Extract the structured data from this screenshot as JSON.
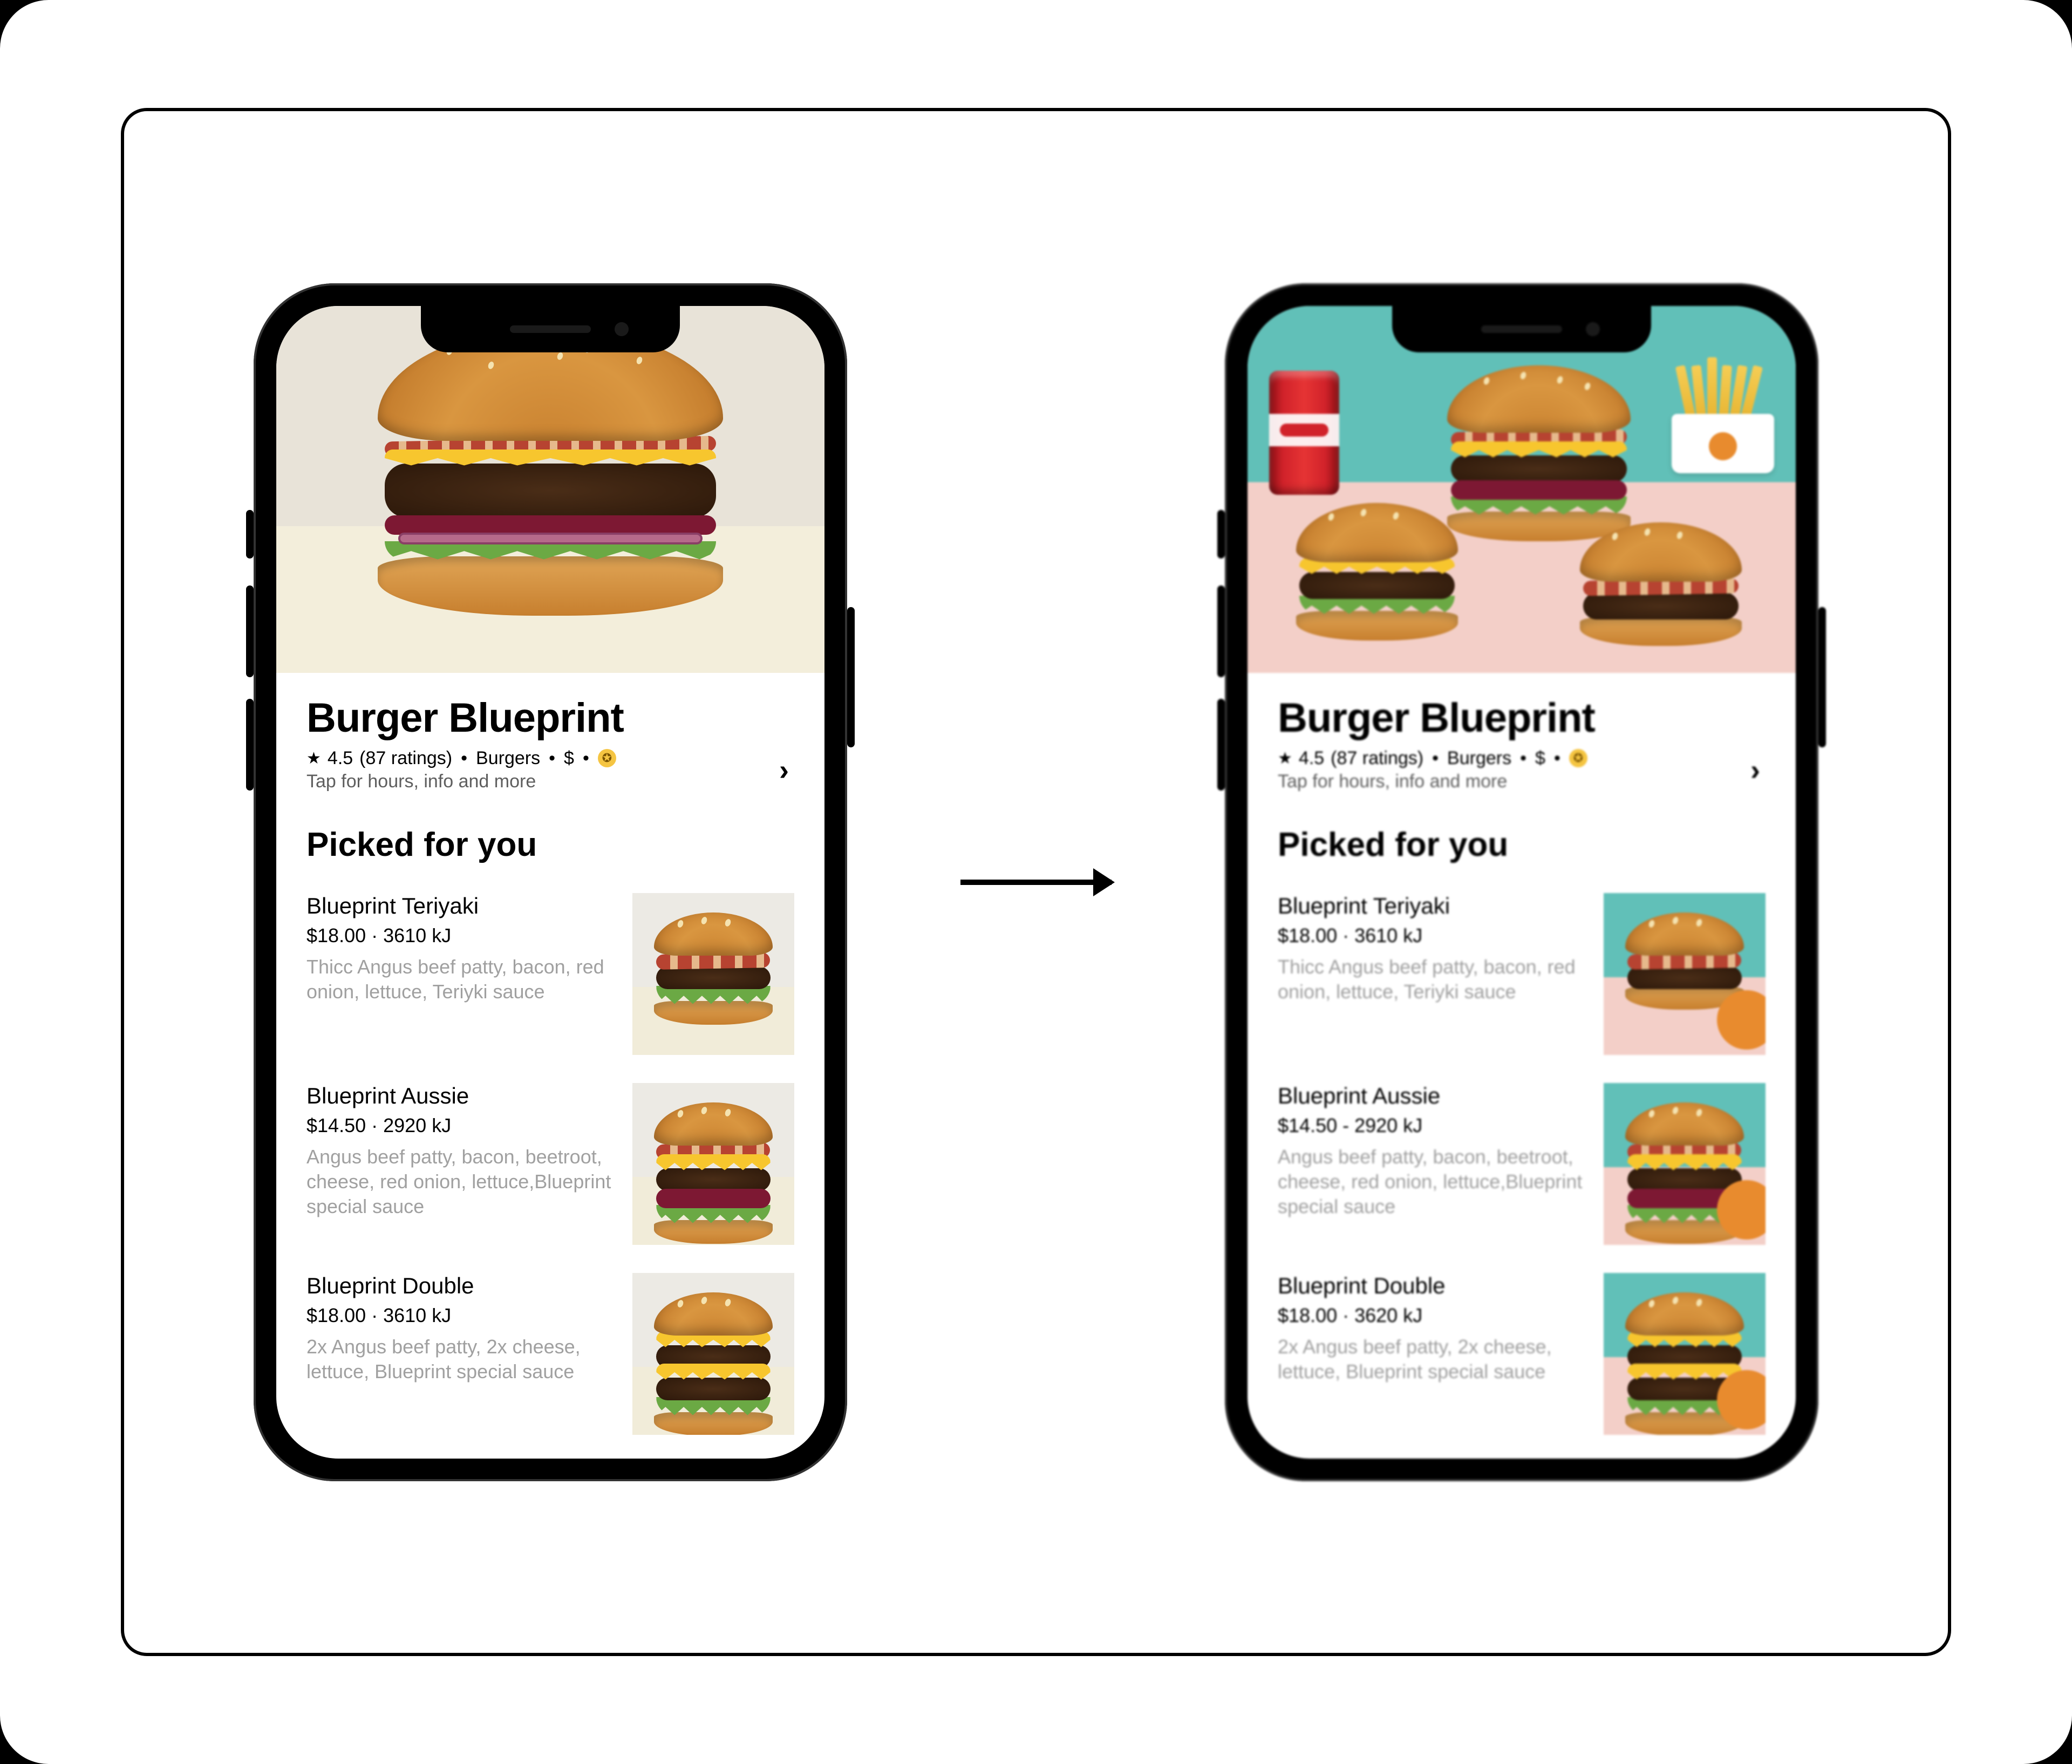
{
  "restaurant": {
    "name": "Burger Blueprint",
    "rating_value": "4.5",
    "rating_count": "(87 ratings)",
    "category": "Burgers",
    "price_tier": "$",
    "tap_hint": "Tap for hours, info and more"
  },
  "section": {
    "heading": "Picked for you"
  },
  "items": [
    {
      "name": "Blueprint Teriyaki",
      "price": "$18.00",
      "kj": "3610 kJ",
      "desc": "Thicc Angus beef patty, bacon, red onion, lettuce, Teriyki sauce"
    },
    {
      "name": "Blueprint Aussie",
      "price": "$14.50",
      "kj": "2920 kJ",
      "desc": "Angus beef patty, bacon, beetroot, cheese, red onion, lettuce,Blueprint special sauce"
    },
    {
      "name": "Blueprint Double",
      "price": "$18.00",
      "kj": "3610 kJ",
      "desc": "2x Angus beef patty, 2x cheese, lettuce, Blueprint special sauce"
    }
  ],
  "phone_b": {
    "items": [
      {
        "kj": "3610 kJ"
      },
      {
        "kj": "2920 kJ"
      },
      {
        "kj": "3620 kJ"
      }
    ]
  },
  "icons": {
    "star": "★",
    "chevron": "›",
    "medal": "✪"
  }
}
